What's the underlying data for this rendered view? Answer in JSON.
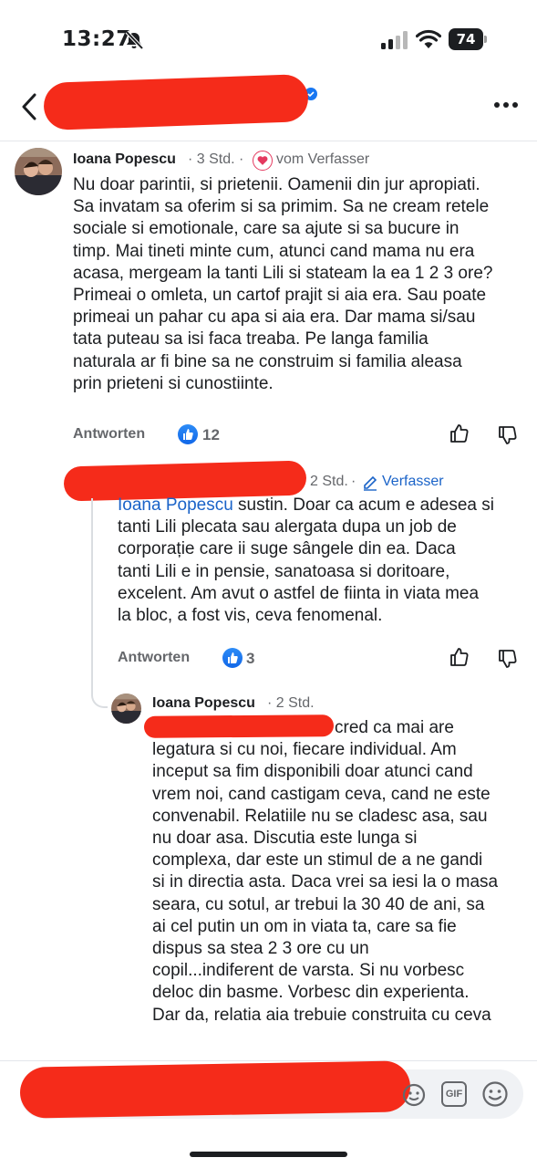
{
  "status_bar": {
    "time": "13:27",
    "battery": "74"
  },
  "comments": [
    {
      "author": "Ioana Popescu",
      "time": "3 Std.",
      "badge": "vom Verfasser",
      "lines": [
        "Nu doar parintii, si prietenii. Oamenii din jur apropiati.",
        "Sa invatam sa oferim si sa primim. Sa ne cream retele",
        "sociale si emotionale, care sa ajute si sa bucure in",
        "timp. Mai tineti minte cum, atunci cand mama nu era",
        "acasa, mergeam la tanti Lili si stateam la ea 1 2 3 ore?",
        "Primeai o omleta, un cartof prajit si aia era. Sau poate",
        "primeai un pahar cu apa si aia era. Dar mama si/sau",
        "tata puteau sa isi faca treaba. Pe langa familia",
        "naturala ar fi bine sa ne construim si familia aleasa",
        "prin prieteni si cunostiinte."
      ],
      "reply_label": "Antworten",
      "likes": "12"
    },
    {
      "author": "",
      "time": "2 Std.",
      "badge": "Verfasser",
      "mention": "Ioana Popescu",
      "lines": [
        " sustin. Doar ca acum e adesea si",
        "tanti Lili plecata sau alergata dupa un job de",
        "corporație care ii suge sângele din ea. Daca",
        "tanti Lili e in pensie, sanatoasa si doritoare,",
        "excelent. Am avut o astfel de fiinta in viata mea",
        "la bloc, a fost vis, ceva fenomenal."
      ],
      "reply_label": "Antworten",
      "likes": "3"
    },
    {
      "author": "Ioana Popescu",
      "time": "2 Std.",
      "lines": [
        "cred ca mai are",
        "legatura si cu noi, fiecare individual. Am",
        "inceput sa fim disponibili doar atunci cand",
        "vrem noi, cand castigam ceva, cand ne este",
        "convenabil. Relatiile nu se cladesc asa, sau",
        "nu doar asa. Discutia este lunga si",
        "complexa, dar este un stimul de a ne gandi",
        "si in directia asta. Daca vrei sa iesi la o masa",
        "seara, cu sotul, ar trebui la 30 40 de ani, sa",
        "ai cel putin un om in viata ta, care sa fie",
        "dispus sa stea 2 3 ore cu un",
        "copil...indiferent de varsta. Si nu vorbesc",
        "deloc din basme. Vorbesc din experienta.",
        "Dar da, relatia aia trebuie construita cu ceva"
      ]
    }
  ],
  "composer": {
    "gif_label": "GIF"
  },
  "colors": {
    "redaction": "#f52b1a",
    "like_blue": "#1877f2",
    "link_blue": "#1a63c8"
  },
  "icons": [
    "bell-slash-icon",
    "signal-icon",
    "wifi-icon",
    "back-chevron-icon",
    "more-dots-icon",
    "heart-icon",
    "pencil-icon",
    "thumbs-up-icon",
    "thumbs-down-icon",
    "sticker-icon",
    "emoji-icon"
  ]
}
